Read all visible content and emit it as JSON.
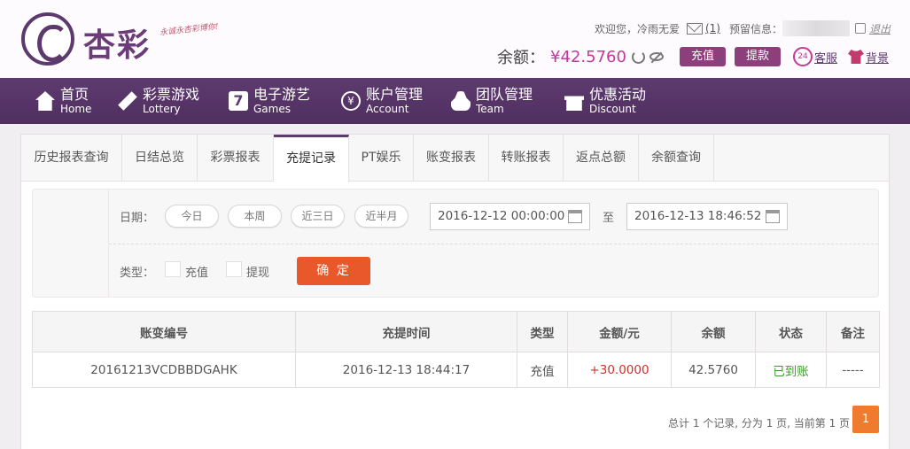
{
  "brand": {
    "logo_text": "杏彩",
    "slogan": "永诚永杏彩博你!"
  },
  "header": {
    "welcome": "欢迎您，",
    "username": "冷雨无爱",
    "message_count": "(1)",
    "reserved_label": "预留信息：",
    "logout": "退出",
    "balance_label": "余额：",
    "balance_value": "¥42.5760",
    "recharge_btn": "充值",
    "withdraw_btn": "提款",
    "service_icon_text": "24",
    "service_link": "客服",
    "background_link": "背景"
  },
  "nav": [
    {
      "zh": "首页",
      "en": "Home"
    },
    {
      "zh": "彩票游戏",
      "en": "Lottery"
    },
    {
      "zh": "电子游艺",
      "en": "Games"
    },
    {
      "zh": "账户管理",
      "en": "Account"
    },
    {
      "zh": "团队管理",
      "en": "Team"
    },
    {
      "zh": "优惠活动",
      "en": "Discount"
    }
  ],
  "nav_icon_glyphs": {
    "games": "7",
    "account": "¥"
  },
  "tabs": [
    "历史报表查询",
    "日结总览",
    "彩票报表",
    "充提记录",
    "PT娱乐",
    "账变报表",
    "转账报表",
    "返点总额",
    "余额查询"
  ],
  "active_tab": "充提记录",
  "filter": {
    "date_label": "日期：",
    "quick_ranges": [
      "今日",
      "本周",
      "近三日",
      "近半月"
    ],
    "start_date": "2016-12-12 00:00:00",
    "to_label": "至",
    "end_date": "2016-12-13 18:46:52",
    "type_label": "类型：",
    "type_options": [
      "充值",
      "提现"
    ],
    "confirm": "确 定"
  },
  "table": {
    "headers": [
      "账变编号",
      "充提时间",
      "类型",
      "金额/元",
      "余额",
      "状态",
      "备注"
    ],
    "rows": [
      [
        "20161213VCDBBDGAHK",
        "2016-12-13 18:44:17",
        "充值",
        "+30.0000",
        "42.5760",
        "已到账",
        "-----"
      ]
    ]
  },
  "pagination": {
    "summary": "总计 1 个记录, 分为 1 页, 当前第 1 页",
    "current_page": "1"
  },
  "colors": {
    "nav_bg": "#5e3b6f",
    "accent_purple": "#8d3f7c",
    "balance_pink": "#c2399b",
    "confirm_orange": "#e8582a",
    "amount_red": "#d12f2f",
    "status_green": "#3a9a2a",
    "pager_orange": "#ef7c2e"
  }
}
